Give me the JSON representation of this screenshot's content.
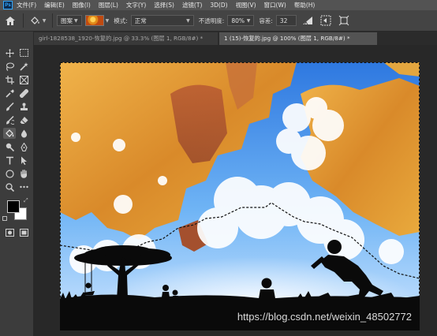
{
  "app": {
    "logo_text": "Ps",
    "menu": [
      "文件(F)",
      "编辑(E)",
      "图像(I)",
      "图层(L)",
      "文字(Y)",
      "选择(S)",
      "滤镜(T)",
      "3D(D)",
      "视图(V)",
      "窗口(W)",
      "帮助(H)"
    ]
  },
  "options": {
    "fill_source": "图案",
    "mode_label": "模式:",
    "mode_value": "正常",
    "opacity_label": "不透明度:",
    "opacity_value": "80%",
    "tolerance_label": "容差:",
    "tolerance_value": "32"
  },
  "tabs": [
    {
      "label": "girl-1828538_1920-恢复的.jpg @ 33.3% (图层 1, RGB/8#) *",
      "active": false
    },
    {
      "label": "1 (15)-恢复的.jpg @ 100% (图层 1, RGB/8#) *",
      "active": true
    }
  ],
  "canvas": {
    "watermark": "https://blog.csdn.net/weixin_48502772"
  },
  "tools": [
    {
      "name": "move-tool",
      "icon": "move-icon"
    },
    {
      "name": "marquee-tool",
      "icon": "marquee-icon"
    },
    {
      "name": "lasso-tool",
      "icon": "lasso-icon"
    },
    {
      "name": "magic-wand-tool",
      "icon": "magic-wand-icon"
    },
    {
      "name": "crop-tool",
      "icon": "crop-icon"
    },
    {
      "name": "frame-tool",
      "icon": "frame-icon"
    },
    {
      "name": "eyedropper-tool",
      "icon": "eyedropper-icon"
    },
    {
      "name": "healing-tool",
      "icon": "bandage-icon"
    },
    {
      "name": "brush-tool",
      "icon": "brush-icon"
    },
    {
      "name": "stamp-tool",
      "icon": "stamp-icon"
    },
    {
      "name": "history-brush-tool",
      "icon": "history-brush-icon"
    },
    {
      "name": "eraser-tool",
      "icon": "eraser-icon"
    },
    {
      "name": "paint-bucket-tool",
      "icon": "paint-bucket-icon"
    },
    {
      "name": "blur-tool",
      "icon": "drop-icon"
    },
    {
      "name": "dodge-tool",
      "icon": "dodge-icon"
    },
    {
      "name": "pen-tool",
      "icon": "pen-icon"
    },
    {
      "name": "type-tool",
      "icon": "type-icon"
    },
    {
      "name": "path-selection-tool",
      "icon": "arrow-icon"
    },
    {
      "name": "shape-tool",
      "icon": "ellipse-icon"
    },
    {
      "name": "hand-tool",
      "icon": "hand-icon"
    },
    {
      "name": "zoom-tool",
      "icon": "zoom-icon"
    },
    {
      "name": "more-tools",
      "icon": "ellipsis-icon"
    }
  ],
  "colors": {
    "foreground": "#000000",
    "background": "#ffffff",
    "sky_blue": "#3f8cea",
    "sand_orange": "#e2a23c"
  }
}
